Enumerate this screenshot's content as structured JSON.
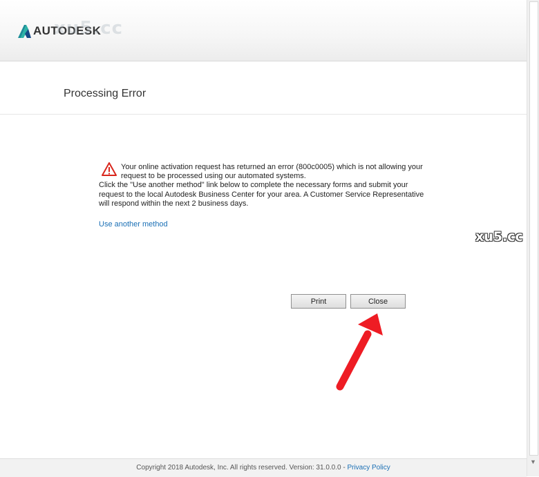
{
  "header": {
    "logo_text": "AUTODESK",
    "watermark": "xu5.cc",
    "logo_icon": "autodesk-logo-icon"
  },
  "page": {
    "title": "Processing Error"
  },
  "error": {
    "icon": "warning-triangle-icon",
    "message": "Your online activation request has returned an error (800c0005) which is not allowing your request to be processed using our automated systems.",
    "instructions": "Click the \"Use another method\" link below to complete the necessary forms and submit your request to the local Autodesk Business Center for your area. A Customer Service Representative will respond within the next 2 business days.",
    "link_label": "Use another method"
  },
  "buttons": {
    "print_label": "Print",
    "close_label": "Close"
  },
  "side_watermark": "xu5.cc",
  "footer": {
    "copyright": "Copyright 2018 Autodesk, Inc. All rights reserved. Version: 31.0.0.0 - ",
    "privacy_label": "Privacy Policy"
  },
  "colors": {
    "link": "#1a6fb5",
    "arrow": "#ee1c24",
    "warning": "#d9261c"
  }
}
